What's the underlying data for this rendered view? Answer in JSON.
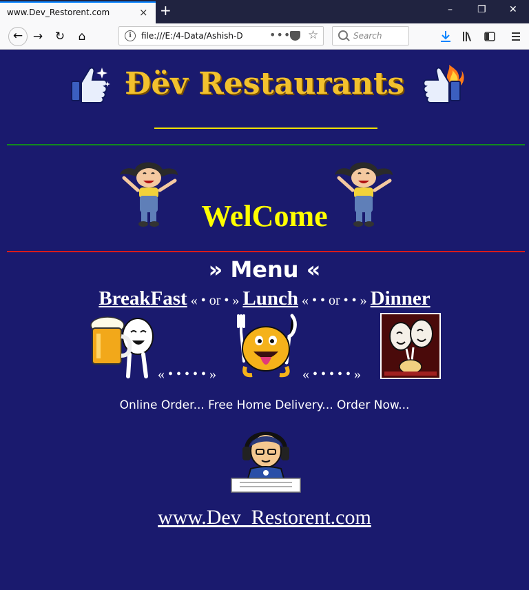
{
  "browser": {
    "tab_title": "www.Dev_Restorent.com",
    "tab_close": "×",
    "new_tab": "+",
    "url": "file:///E:/4-Data/Ashish-D",
    "url_menu": "•••",
    "search_placeholder": "Search",
    "window_controls": [
      "–",
      "❐",
      "✕"
    ]
  },
  "page": {
    "brand": "Đëv Restaurants",
    "welcome": "WelCome",
    "menu_heading": "» Menu «",
    "meals": {
      "breakfast": "BreakFast",
      "sep1": "« • or • »",
      "lunch": "Lunch",
      "sep2": "« • • or • • »",
      "dinner": "Dinner"
    },
    "dots_left": "« • • • • • »",
    "dots_right": "« • • • • • »",
    "tagline": "Online Order... Free Home Delivery... Order Now...",
    "site_link": "www.Dev_Restorent.com"
  },
  "colors": {
    "page_bg": "#1a1a6e",
    "brand": "#f2c12e",
    "welcome": "#ffff00",
    "green_rule": "#128a1e",
    "red_rule": "#d81b1b",
    "yellow_rule": "#f2e200"
  }
}
